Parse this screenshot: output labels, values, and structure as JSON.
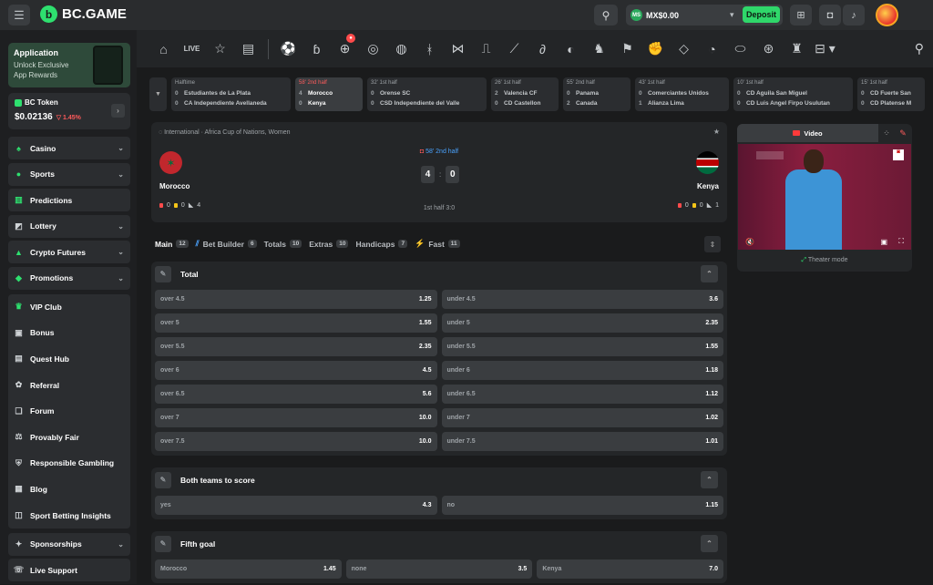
{
  "header": {
    "logo_text": "BC.GAME",
    "wallet_amount": "MX$0.00",
    "currency_icon": "MS",
    "deposit_label": "Deposit"
  },
  "sidebar": {
    "app_card": {
      "title": "Application",
      "subtitle": "Unlock Exclusive App Rewards"
    },
    "token": {
      "label": "BC Token",
      "price": "$0.02136",
      "change": "▽ 1.45%"
    },
    "items": [
      {
        "label": "Casino",
        "icon": "cards-icon",
        "chevron": true
      },
      {
        "label": "Sports",
        "icon": "ball-icon",
        "chevron": true
      },
      {
        "label": "Predictions",
        "icon": "chart-icon",
        "chevron": false
      },
      {
        "label": "Lottery",
        "icon": "ticket-icon",
        "chevron": true
      },
      {
        "label": "Crypto Futures",
        "icon": "futures-icon",
        "chevron": true
      },
      {
        "label": "Promotions",
        "icon": "promo-icon",
        "chevron": true
      }
    ],
    "group_items": [
      {
        "label": "VIP Club",
        "icon": "crown-icon"
      },
      {
        "label": "Bonus",
        "icon": "gift-icon"
      },
      {
        "label": "Quest Hub",
        "icon": "quest-icon"
      },
      {
        "label": "Referral",
        "icon": "referral-icon"
      },
      {
        "label": "Forum",
        "icon": "forum-icon"
      },
      {
        "label": "Provably Fair",
        "icon": "fair-icon"
      },
      {
        "label": "Responsible Gambling",
        "icon": "shield-icon"
      },
      {
        "label": "Blog",
        "icon": "blog-icon"
      },
      {
        "label": "Sport Betting Insights",
        "icon": "insights-icon"
      }
    ],
    "bottom_items": [
      {
        "label": "Sponsorships",
        "icon": "sponsor-icon",
        "chevron": true
      },
      {
        "label": "Live Support",
        "icon": "support-icon",
        "chevron": false
      }
    ]
  },
  "live_matches": [
    {
      "time": "Halftime",
      "live": false,
      "team1": "Estudiantes de La Plata",
      "score1": "0",
      "team2": "CA Independiente Avellaneda",
      "score2": "0"
    },
    {
      "time": "58' 2nd half",
      "live": true,
      "team1": "Morocco",
      "score1": "4",
      "team2": "Kenya",
      "score2": "0"
    },
    {
      "time": "32' 1st half",
      "live": false,
      "team1": "Orense SC",
      "score1": "0",
      "team2": "CSD Independiente del Valle",
      "score2": "0"
    },
    {
      "time": "26' 1st half",
      "live": false,
      "team1": "Valencia CF",
      "score1": "2",
      "team2": "CD Castellon",
      "score2": "0"
    },
    {
      "time": "55' 2nd half",
      "live": false,
      "team1": "Panama",
      "score1": "0",
      "team2": "Canada",
      "score2": "2"
    },
    {
      "time": "43' 1st half",
      "live": false,
      "team1": "Comerciantes Unidos",
      "score1": "0",
      "team2": "Alianza Lima",
      "score2": "1"
    },
    {
      "time": "10' 1st half",
      "live": false,
      "team1": "CD Aguila San Miguel",
      "score1": "0",
      "team2": "CD Luis Angel Firpo Usulutan",
      "score2": "0"
    },
    {
      "time": "15' 1st half",
      "live": false,
      "team1": "CD Fuerte San",
      "score1": "0",
      "team2": "CD Platense M",
      "score2": "0"
    }
  ],
  "match": {
    "league": "International · Africa Cup of Nations, Women",
    "period": "58' 2nd half",
    "home": {
      "name": "Morocco",
      "score": "4",
      "red": "0",
      "yellow": "0",
      "corners": "4"
    },
    "away": {
      "name": "Kenya",
      "score": "0",
      "red": "0",
      "yellow": "0",
      "corners": "1"
    },
    "half_score": "1st half 3:0"
  },
  "video": {
    "tab_label": "Video",
    "theater_label": "Theater mode"
  },
  "market_tabs": [
    {
      "label": "Main",
      "count": "12",
      "active": true
    },
    {
      "label": "Bet Builder",
      "count": "6",
      "active": false
    },
    {
      "label": "Totals",
      "count": "10",
      "active": false
    },
    {
      "label": "Extras",
      "count": "10",
      "active": false
    },
    {
      "label": "Handicaps",
      "count": "7",
      "active": false
    },
    {
      "label": "Fast",
      "count": "11",
      "active": false
    }
  ],
  "markets": {
    "total": {
      "title": "Total",
      "rows": [
        [
          {
            "label": "over 4.5",
            "odd": "1.25"
          },
          {
            "label": "under 4.5",
            "odd": "3.6"
          }
        ],
        [
          {
            "label": "over 5",
            "odd": "1.55"
          },
          {
            "label": "under 5",
            "odd": "2.35"
          }
        ],
        [
          {
            "label": "over 5.5",
            "odd": "2.35"
          },
          {
            "label": "under 5.5",
            "odd": "1.55"
          }
        ],
        [
          {
            "label": "over 6",
            "odd": "4.5"
          },
          {
            "label": "under 6",
            "odd": "1.18"
          }
        ],
        [
          {
            "label": "over 6.5",
            "odd": "5.6"
          },
          {
            "label": "under 6.5",
            "odd": "1.12"
          }
        ],
        [
          {
            "label": "over 7",
            "odd": "10.0"
          },
          {
            "label": "under 7",
            "odd": "1.02"
          }
        ],
        [
          {
            "label": "over 7.5",
            "odd": "10.0"
          },
          {
            "label": "under 7.5",
            "odd": "1.01"
          }
        ]
      ]
    },
    "btts": {
      "title": "Both teams to score",
      "rows": [
        [
          {
            "label": "yes",
            "odd": "4.3"
          },
          {
            "label": "no",
            "odd": "1.15"
          }
        ]
      ]
    },
    "fifth_goal": {
      "title": "Fifth goal",
      "rows": [
        [
          {
            "label": "Morocco",
            "odd": "1.45"
          },
          {
            "label": "none",
            "odd": "3.5"
          },
          {
            "label": "Kenya",
            "odd": "7.0"
          }
        ]
      ]
    }
  }
}
